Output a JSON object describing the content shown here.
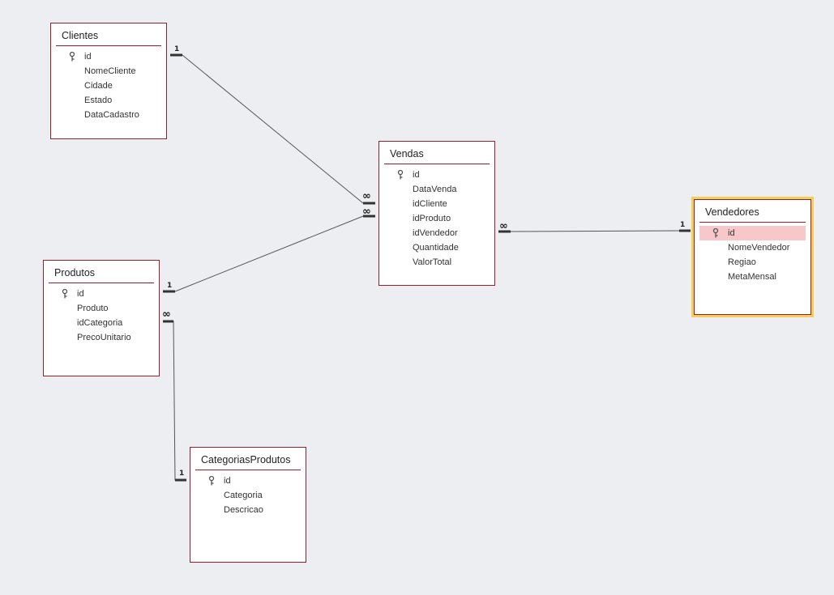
{
  "tables": {
    "clientes": {
      "name": "Clientes",
      "fields": [
        "id",
        "NomeCliente",
        "Cidade",
        "Estado",
        "DataCadastro"
      ]
    },
    "vendas": {
      "name": "Vendas",
      "fields": [
        "id",
        "DataVenda",
        "idCliente",
        "idProduto",
        "idVendedor",
        "Quantidade",
        "ValorTotal"
      ]
    },
    "vendedores": {
      "name": "Vendedores",
      "fields": [
        "id",
        "NomeVendedor",
        "Regiao",
        "MetaMensal"
      ]
    },
    "produtos": {
      "name": "Produtos",
      "fields": [
        "id",
        "Produto",
        "idCategoria",
        "PrecoUnitario"
      ]
    },
    "categorias": {
      "name": "CategoriasProdutos",
      "fields": [
        "id",
        "Categoria",
        "Descricao"
      ]
    }
  },
  "relationships": [
    {
      "one": "Clientes.id",
      "many": "Vendas.idCliente",
      "one_label": "1",
      "many_label": "∞"
    },
    {
      "one": "Produtos.id",
      "many": "Vendas.idProduto",
      "one_label": "1",
      "many_label": "∞"
    },
    {
      "one": "Vendedores.id",
      "many": "Vendas.idVendedor",
      "one_label": "1",
      "many_label": "∞"
    },
    {
      "one": "CategoriasProdutos.id",
      "many": "Produtos.idCategoria",
      "one_label": "1",
      "many_label": "∞"
    }
  ],
  "selected_table": "Vendedores",
  "selected_field": "id",
  "colors": {
    "border": "#9b1c2a",
    "selection": "#f5cd5a",
    "highlight": "#f8c7c9",
    "background": "#eceef1"
  },
  "icons": {
    "primary_key": "key-icon"
  }
}
